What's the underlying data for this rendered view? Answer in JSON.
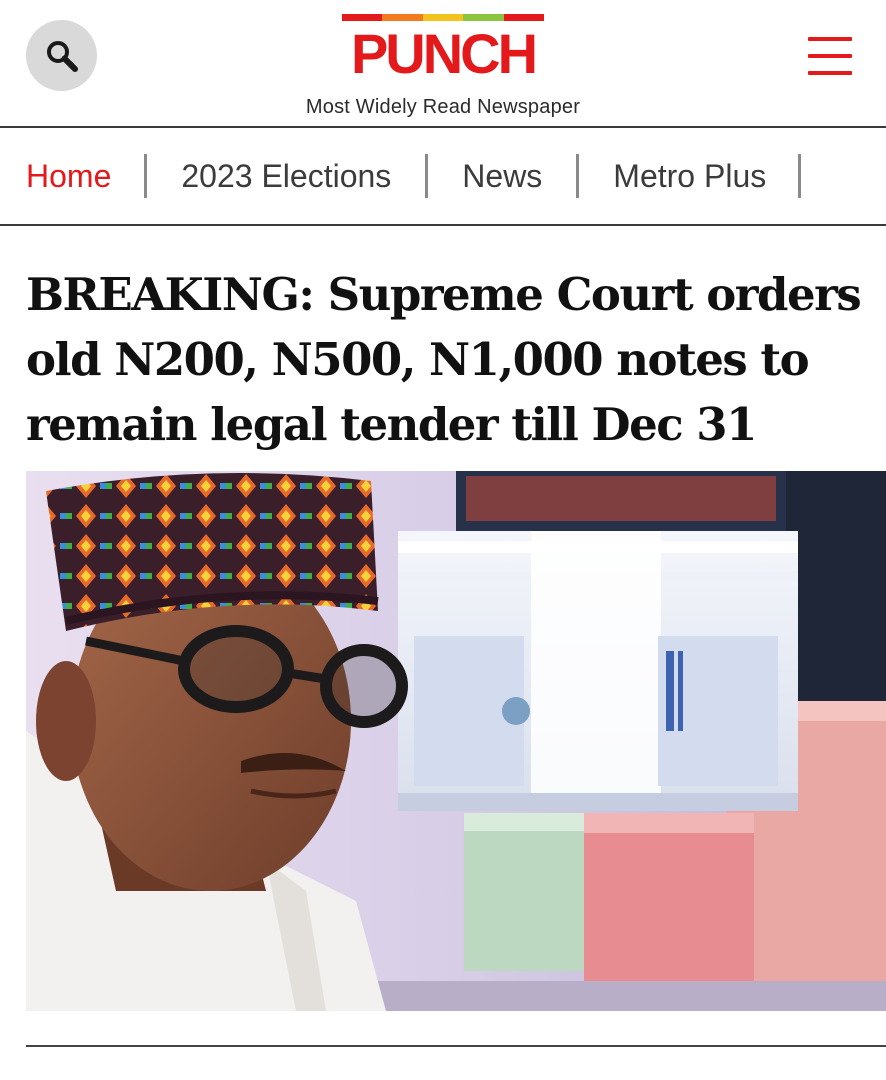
{
  "header": {
    "logo_text": "PUNCH",
    "tagline": "Most Widely Read Newspaper",
    "logo_bar_colors": [
      "#e3191b",
      "#f47a1f",
      "#f4c21c",
      "#8bc53f",
      "#e3191b"
    ],
    "search_icon": "search-icon",
    "menu_icon": "hamburger-menu-icon"
  },
  "nav": {
    "items": [
      {
        "label": "Home",
        "active": true
      },
      {
        "label": "2023 Elections",
        "active": false
      },
      {
        "label": "News",
        "active": false
      },
      {
        "label": "Metro Plus",
        "active": false
      }
    ]
  },
  "article": {
    "headline": "BREAKING: Supreme Court orders old N200, N500, N1,000 notes to remain legal tender till Dec 31",
    "image_alt": "Buhari beside stacks of new naira notes"
  },
  "colors": {
    "brand_red": "#e3191b",
    "nav_text": "#3b3b3b",
    "headline_text": "#111111"
  }
}
